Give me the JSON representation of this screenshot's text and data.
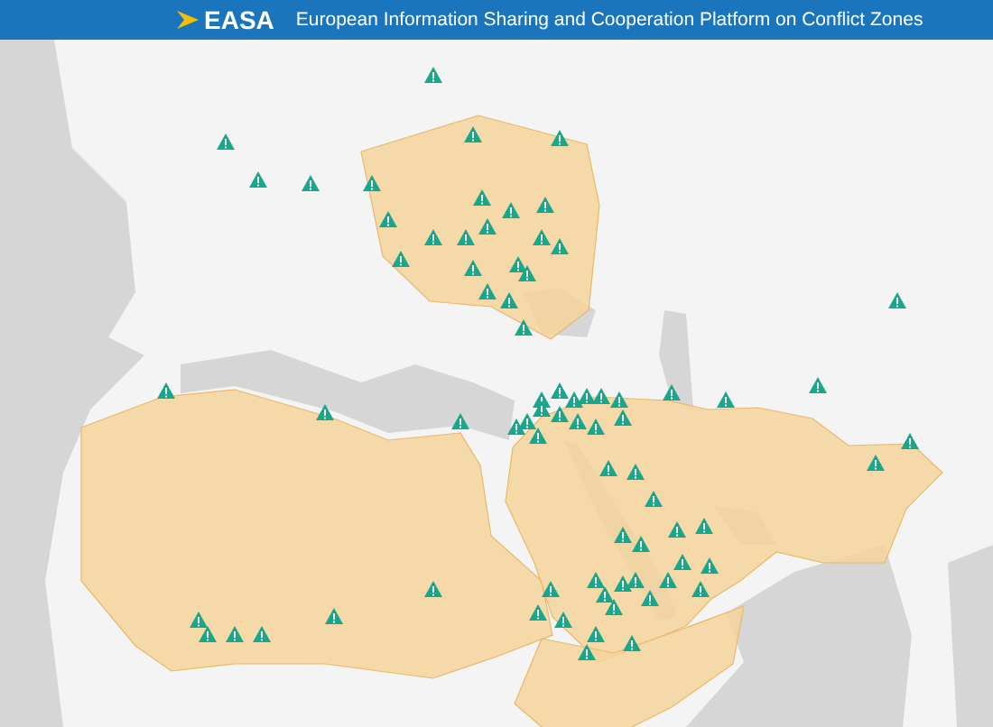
{
  "header": {
    "logo_text": "EASA",
    "title": "European Information Sharing and Cooperation Platform on Conflict Zones"
  }
}
